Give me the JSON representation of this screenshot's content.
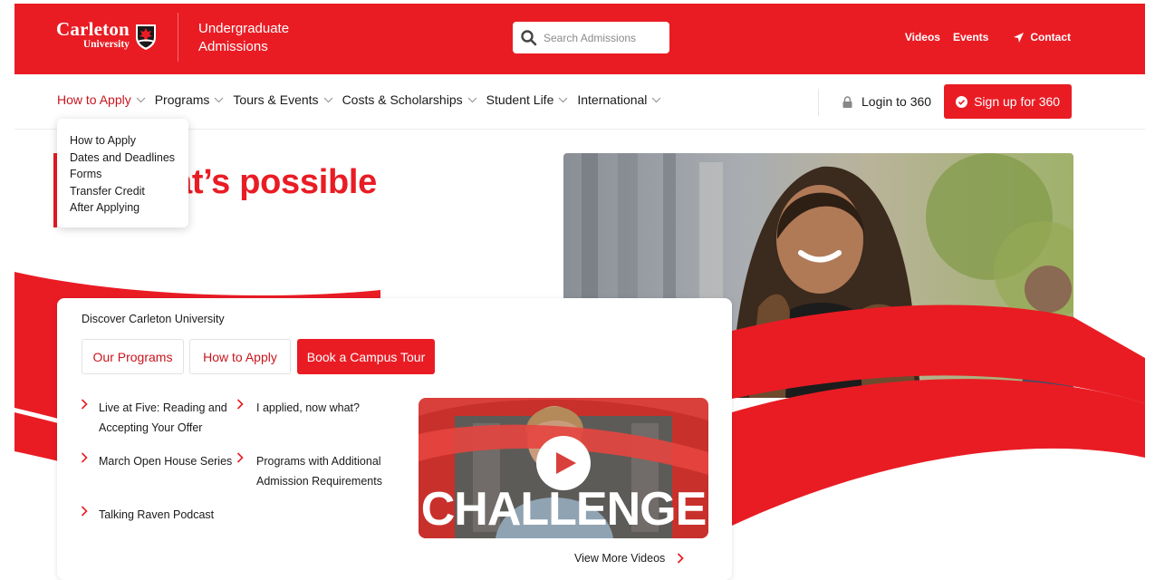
{
  "header": {
    "logo_name": "Carleton",
    "logo_sub": "University",
    "site_title": "Undergraduate Admissions",
    "search_placeholder": "Search Admissions",
    "links": [
      "Videos",
      "Events",
      "Contact"
    ]
  },
  "nav": {
    "items": [
      "How to Apply",
      "Programs",
      "Tours & Events",
      "Costs & Scholarships",
      "Student Life",
      "International"
    ],
    "login_label": "Login to 360",
    "signup_label": "Sign up for 360"
  },
  "dropdown": {
    "items": [
      "How to Apply",
      "Dates and Deadlines",
      "Forms",
      "Transfer Credit",
      "After Applying"
    ]
  },
  "hero": {
    "title": "nge what’s possible"
  },
  "card": {
    "heading": "Discover Carleton University",
    "buttons": [
      "Our Programs",
      "How to Apply",
      "Book a Campus Tour"
    ],
    "links_left": [
      "Live at Five: Reading and Accepting Your Offer",
      "March Open House Series",
      "Talking Raven Podcast"
    ],
    "links_right": [
      "I applied, now what?",
      "Programs with Additional Admission Requirements"
    ],
    "video_text": "CHALLENGE",
    "view_more_label": "View More Videos"
  },
  "colors": {
    "brand_red": "#e91c24",
    "link_red": "#c9151d"
  },
  "icons": [
    "carleton-shield-icon",
    "search-icon",
    "send-icon",
    "chevron-down-icon",
    "lock-icon",
    "check-circle-icon",
    "chevron-right-icon",
    "play-icon"
  ]
}
